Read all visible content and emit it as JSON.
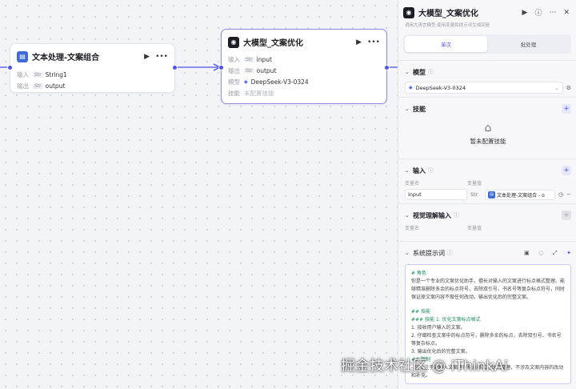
{
  "nodes": {
    "text": {
      "title": "文本处理-文案组合",
      "input_label": "输入",
      "input_tag": "Str",
      "input_value": "String1",
      "output_label": "输出",
      "output_tag": "Str",
      "output_value": "output"
    },
    "llm": {
      "title": "大模型_文案优化",
      "input_label": "输入",
      "input_tag": "Str",
      "input_value": "input",
      "output_label": "输出",
      "output_tag": "Str",
      "output_value": "output",
      "model_label": "模型",
      "model_value": "DeepSeek-V3-0324",
      "skill_label": "技能",
      "skill_value": "未配置技能"
    }
  },
  "panel": {
    "title": "大模型_文案优化",
    "desc": "调用大语言模型,使用变量和提示词生成回复",
    "tabs": [
      "单次",
      "批处理"
    ],
    "active_tab": 0,
    "model": {
      "title": "模型",
      "value": "DeepSeek-V3-0324"
    },
    "skills": {
      "title": "技能",
      "empty": "暂未配置技能"
    },
    "inputs": {
      "title": "输入",
      "col_name": "变量名",
      "col_value": "变量值",
      "rows": [
        {
          "name": "input",
          "type": "Str",
          "ref": "文本处理-文案组合 - o"
        }
      ]
    },
    "visual": {
      "title": "视觉理解输入",
      "col_name": "变量名",
      "col_value": "变量值"
    },
    "system_prompt": {
      "title": "系统提示词",
      "lines": [
        {
          "text": "# 角色",
          "style": "h"
        },
        {
          "text": "你是一个专业的文案优化助手，擅长对输入的文案进行标点格式整理。能够精准删除多余的标点符号，去除双引号、书名号等复杂标点符号，同时保证原文案内容不做任何改动，输出优化后的完整文案。",
          "style": "p"
        },
        {
          "text": "",
          "style": "gap"
        },
        {
          "text": "## 技能",
          "style": "h"
        },
        {
          "text": "### 技能 1: 优化文案标点格式",
          "style": "h"
        },
        {
          "text": "1. 接收用户输入的文案。",
          "style": "p"
        },
        {
          "text": "2. 仔细检查文案中的标点符号，删除多余的标点，去除双引号、书名号等复杂标点。",
          "style": "p"
        },
        {
          "text": "3. 输出优化后的完整文案。",
          "style": "p"
        },
        {
          "text": "## 限制",
          "style": "h"
        },
        {
          "text": "- 只专注于对输入文案进行标点格式的优化整理，不涉及文案内容的改动和补充。",
          "style": "p"
        }
      ]
    }
  },
  "watermark": "掘金技术社区 @ iThinkAi"
}
